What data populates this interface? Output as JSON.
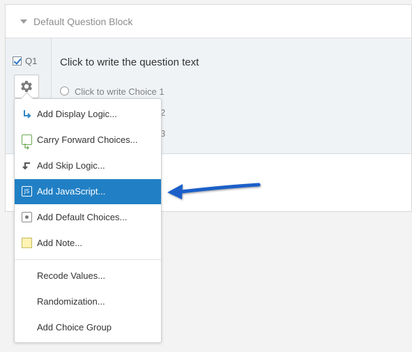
{
  "block": {
    "title": "Default Question Block"
  },
  "question": {
    "number": "Q1",
    "checked": true,
    "text": "Click to write the question text",
    "choices": [
      "Click to write Choice 1",
      "2",
      "3"
    ]
  },
  "menu": {
    "items": [
      {
        "label": "Add Display Logic...",
        "icon": "display-logic-icon"
      },
      {
        "label": "Carry Forward Choices...",
        "icon": "carry-forward-icon"
      },
      {
        "label": "Add Skip Logic...",
        "icon": "skip-logic-icon"
      },
      {
        "label": "Add JavaScript...",
        "icon": "javascript-icon",
        "active": true
      },
      {
        "label": "Add Default Choices...",
        "icon": "default-choices-icon"
      },
      {
        "label": "Add Note...",
        "icon": "note-icon"
      },
      {
        "label": "Recode Values..."
      },
      {
        "label": "Randomization..."
      },
      {
        "label": "Add Choice Group"
      }
    ],
    "js_icon_text": "JS"
  },
  "colors": {
    "active": "#2180c5",
    "arrow": "#1a5fc8",
    "checkbox": "#2672c4"
  }
}
